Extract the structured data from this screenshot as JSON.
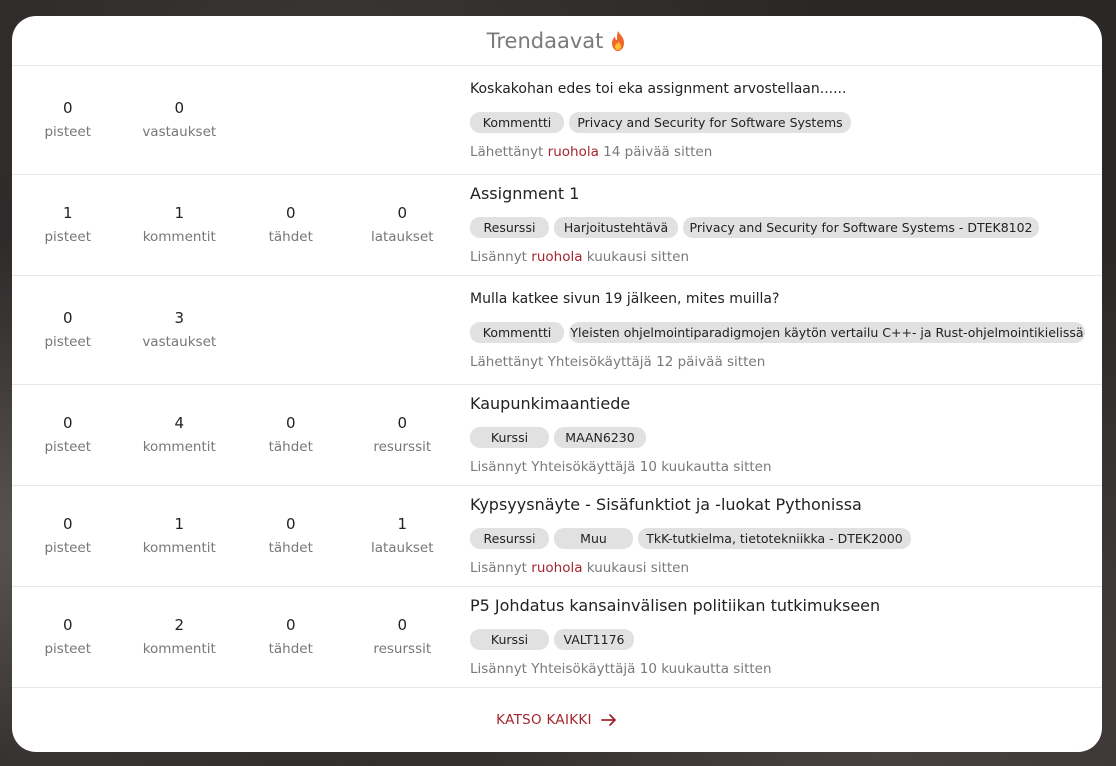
{
  "header": {
    "title": "Trendaavat",
    "icon": "fire-icon"
  },
  "items": [
    {
      "title": "Koskakohan edes toi eka assignment arvostellaan......",
      "small": true,
      "stats": [
        {
          "value": "0",
          "label": "pisteet"
        },
        {
          "value": "0",
          "label": "vastaukset"
        }
      ],
      "tags": [
        {
          "label": "Kommentti",
          "width": 94
        },
        {
          "label": "Privacy and Security for Software Systems",
          "width": 282
        }
      ],
      "meta": {
        "prefix": "Lähettänyt",
        "user": "ruohola",
        "user_red": true,
        "time": "14 päivää sitten"
      }
    },
    {
      "title": "Assignment 1",
      "small": false,
      "stats": [
        {
          "value": "1",
          "label": "pisteet"
        },
        {
          "value": "1",
          "label": "kommentit"
        },
        {
          "value": "0",
          "label": "tähdet"
        },
        {
          "value": "0",
          "label": "lataukset"
        }
      ],
      "tags": [
        {
          "label": "Resurssi",
          "width": 79
        },
        {
          "label": "Harjoitustehtävä",
          "width": 124
        },
        {
          "label": "Privacy and Security for Software Systems - DTEK8102",
          "width": 356
        }
      ],
      "meta": {
        "prefix": "Lisännyt",
        "user": "ruohola",
        "user_red": true,
        "time": "kuukausi sitten"
      }
    },
    {
      "title": "Mulla katkee sivun 19 jälkeen, mites muilla?",
      "small": true,
      "stats": [
        {
          "value": "0",
          "label": "pisteet"
        },
        {
          "value": "3",
          "label": "vastaukset"
        }
      ],
      "tags": [
        {
          "label": "Kommentti",
          "width": 94
        },
        {
          "label": "Yleisten ohjelmointiparadigmojen käytön vertailu C++- ja Rust-ohjelmointikielissä",
          "width": 516
        }
      ],
      "meta": {
        "prefix": "Lähettänyt",
        "user": "Yhteisökäyttäjä",
        "user_red": false,
        "time": "12 päivää sitten"
      }
    },
    {
      "title": "Kaupunkimaantiede",
      "small": false,
      "stats": [
        {
          "value": "0",
          "label": "pisteet"
        },
        {
          "value": "4",
          "label": "kommentit"
        },
        {
          "value": "0",
          "label": "tähdet"
        },
        {
          "value": "0",
          "label": "resurssit"
        }
      ],
      "tags": [
        {
          "label": "Kurssi",
          "width": 79
        },
        {
          "label": "MAAN6230",
          "width": 92
        }
      ],
      "meta": {
        "prefix": "Lisännyt",
        "user": "Yhteisökäyttäjä",
        "user_red": false,
        "time": "10 kuukautta sitten"
      }
    },
    {
      "title": "Kypsyysnäyte - Sisäfunktiot ja -luokat Pythonissa",
      "small": false,
      "stats": [
        {
          "value": "0",
          "label": "pisteet"
        },
        {
          "value": "1",
          "label": "kommentit"
        },
        {
          "value": "0",
          "label": "tähdet"
        },
        {
          "value": "1",
          "label": "lataukset"
        }
      ],
      "tags": [
        {
          "label": "Resurssi",
          "width": 79
        },
        {
          "label": "Muu",
          "width": 79
        },
        {
          "label": "TkK-tutkielma, tietotekniikka - DTEK2000",
          "width": 273
        }
      ],
      "meta": {
        "prefix": "Lisännyt",
        "user": "ruohola",
        "user_red": true,
        "time": "kuukausi sitten"
      }
    },
    {
      "title": "P5 Johdatus kansainvälisen politiikan tutkimukseen",
      "small": false,
      "stats": [
        {
          "value": "0",
          "label": "pisteet"
        },
        {
          "value": "2",
          "label": "kommentit"
        },
        {
          "value": "0",
          "label": "tähdet"
        },
        {
          "value": "0",
          "label": "resurssit"
        }
      ],
      "tags": [
        {
          "label": "Kurssi",
          "width": 79
        },
        {
          "label": "VALT1176",
          "width": 80
        }
      ],
      "meta": {
        "prefix": "Lisännyt",
        "user": "Yhteisökäyttäjä",
        "user_red": false,
        "time": "10 kuukautta sitten"
      }
    }
  ],
  "footer": {
    "see_all_label": "KATSO KAIKKI",
    "icon": "arrow-right-icon"
  },
  "colors": {
    "accent": "#a3262f",
    "tag_bg": "#e1e1e1",
    "muted": "#7a7a7a"
  }
}
